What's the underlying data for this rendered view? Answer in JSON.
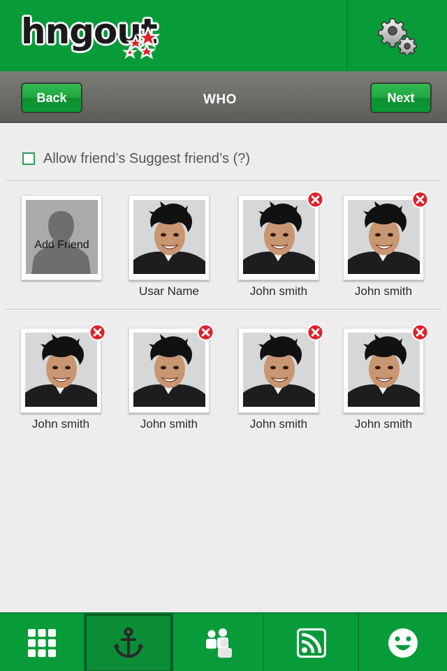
{
  "app": {
    "logo_text": "hngout"
  },
  "toolbar": {
    "back_label": "Back",
    "title": "WHO",
    "next_label": "Next"
  },
  "allow": {
    "label": "Allow friend’s  Suggest friend’s (?)",
    "checked": false
  },
  "add_friend": {
    "label": "Add Friend"
  },
  "friends_row1": [
    {
      "name": "Usar Name",
      "removable": false
    },
    {
      "name": "John smith",
      "removable": true
    },
    {
      "name": "John smith",
      "removable": true
    }
  ],
  "friends_row2": [
    {
      "name": "John smith",
      "removable": true
    },
    {
      "name": "John smith",
      "removable": true
    },
    {
      "name": "John smith",
      "removable": true
    },
    {
      "name": "John smith",
      "removable": true
    }
  ],
  "bottom_nav": [
    {
      "icon": "grid-icon",
      "active": false
    },
    {
      "icon": "anchor-icon",
      "active": true
    },
    {
      "icon": "people-icon",
      "active": false
    },
    {
      "icon": "rss-icon",
      "active": false
    },
    {
      "icon": "smiley-icon",
      "active": false
    }
  ],
  "colors": {
    "brand_green": "#079b3a",
    "toolbar_gray": "#6a6a66",
    "remove_red": "#e0202a"
  }
}
